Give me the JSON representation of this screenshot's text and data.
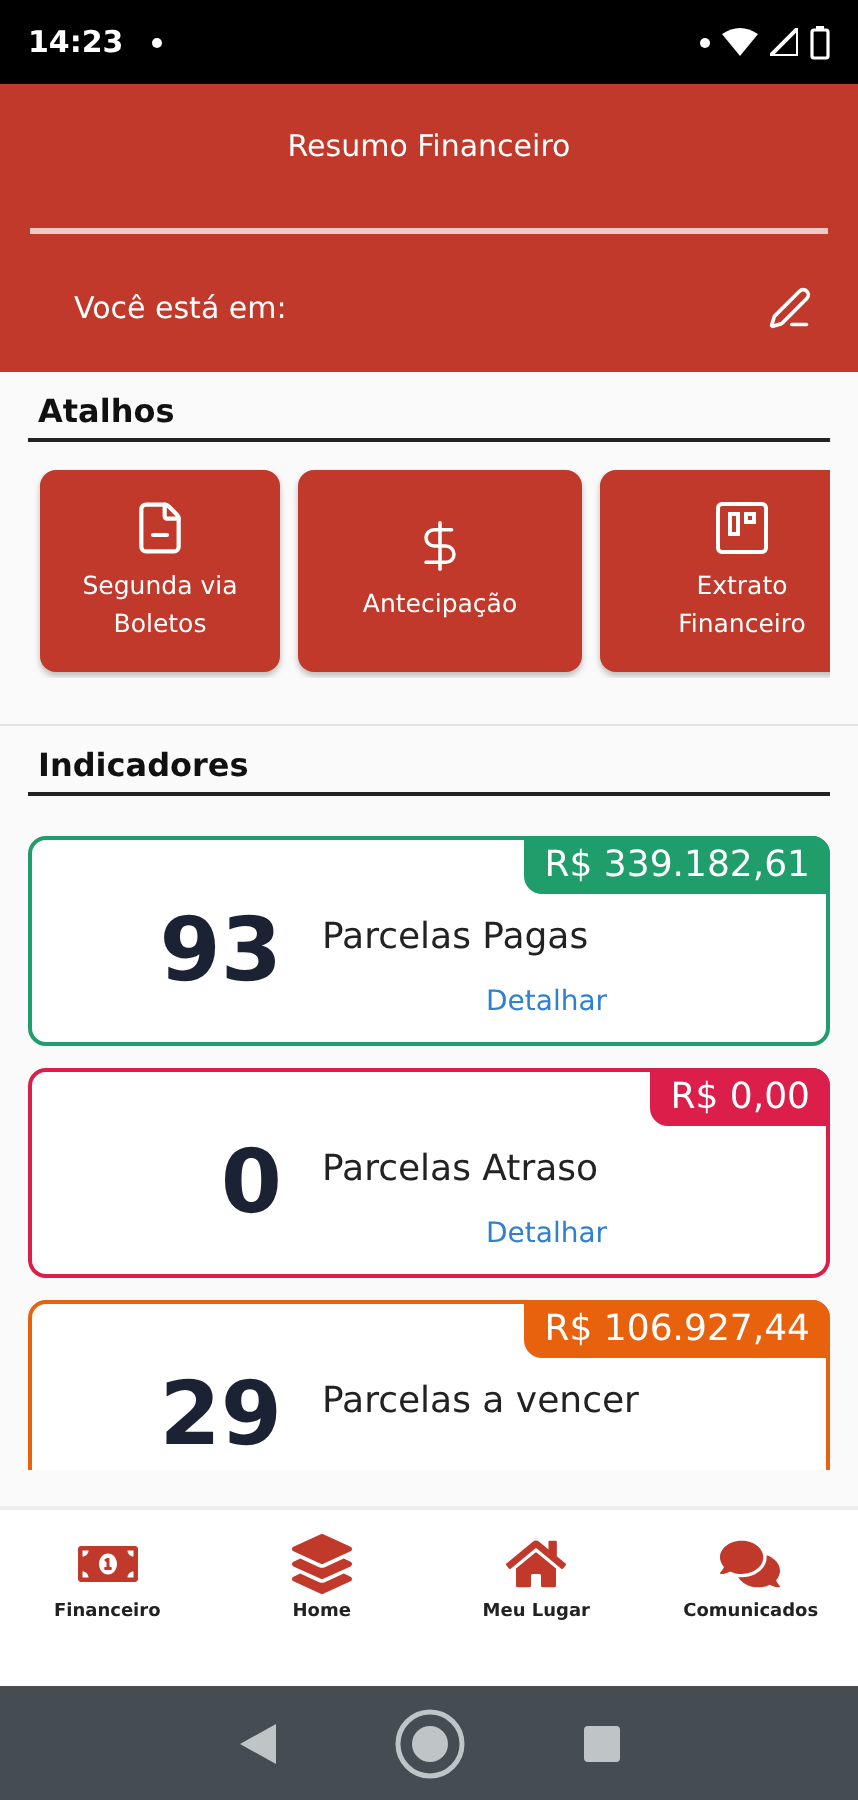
{
  "status_bar": {
    "time": "14:23"
  },
  "header": {
    "title": "Resumo Financeiro",
    "location_label": "Você está em:"
  },
  "shortcuts": {
    "title": "Atalhos",
    "items": [
      {
        "kind": "document",
        "label": "Segunda via Boletos"
      },
      {
        "kind": "dollar",
        "label": "Antecipação"
      },
      {
        "kind": "statement",
        "label": "Extrato Financeiro"
      }
    ]
  },
  "indicators": {
    "title": "Indicadores",
    "cards": [
      {
        "amount": "R$ 339.182,61",
        "count": "93",
        "label": "Parcelas Pagas",
        "link": "Detalhar",
        "color": "#1f9d6b"
      },
      {
        "amount": "R$ 0,00",
        "count": "0",
        "label": "Parcelas Atraso",
        "link": "Detalhar",
        "color": "#dc1f4a"
      },
      {
        "amount": "R$ 106.927,44",
        "count": "29",
        "label": "Parcelas a vencer",
        "color": "#e8620e"
      }
    ]
  },
  "bottom_nav": [
    {
      "kind": "money",
      "label": "Financeiro"
    },
    {
      "kind": "layers",
      "label": "Home"
    },
    {
      "kind": "house",
      "label": "Meu Lugar"
    },
    {
      "kind": "chat",
      "label": "Comunicados"
    }
  ]
}
